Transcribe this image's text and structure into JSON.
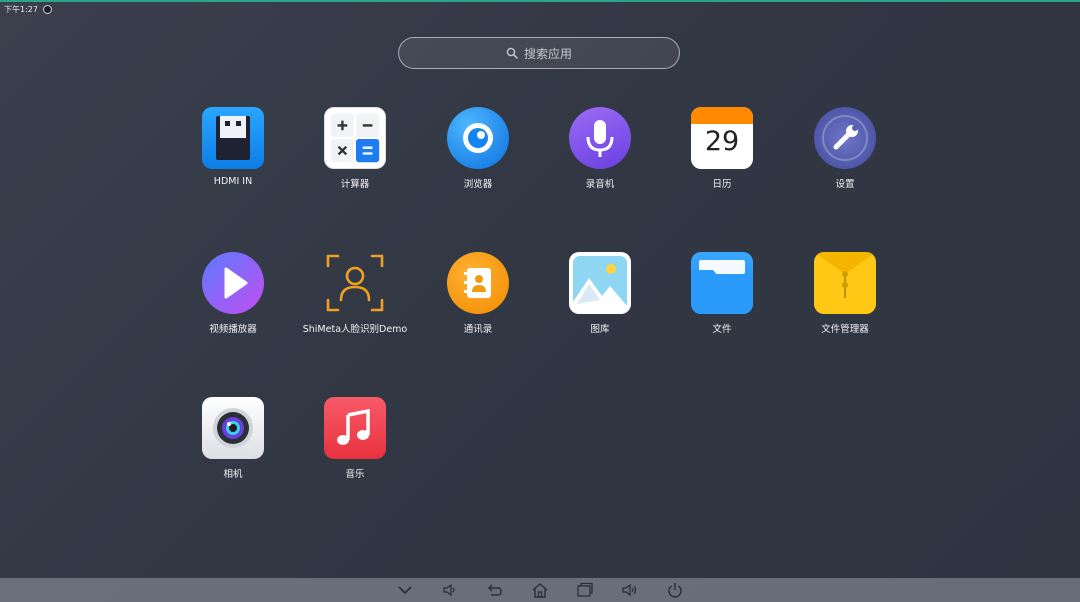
{
  "status": {
    "time": "下午1:27"
  },
  "search": {
    "placeholder": "搜索应用"
  },
  "apps": [
    {
      "id": "hdmi-in",
      "label": "HDMI IN",
      "icon": "usb-drive-icon"
    },
    {
      "id": "calculator",
      "label": "计算器",
      "icon": "calculator-icon"
    },
    {
      "id": "browser",
      "label": "浏览器",
      "icon": "browser-icon"
    },
    {
      "id": "recorder",
      "label": "录音机",
      "icon": "microphone-icon"
    },
    {
      "id": "calendar",
      "label": "日历",
      "icon": "calendar-icon",
      "day": "29"
    },
    {
      "id": "settings",
      "label": "设置",
      "icon": "wrench-icon"
    },
    {
      "id": "video-player",
      "label": "视频播放器",
      "icon": "play-icon"
    },
    {
      "id": "face-demo",
      "label": "ShiMeta人脸识别Demo",
      "icon": "face-scan-icon"
    },
    {
      "id": "contacts",
      "label": "通讯录",
      "icon": "contacts-icon"
    },
    {
      "id": "gallery",
      "label": "图库",
      "icon": "gallery-icon"
    },
    {
      "id": "files",
      "label": "文件",
      "icon": "folder-icon"
    },
    {
      "id": "file-manager",
      "label": "文件管理器",
      "icon": "file-manager-icon"
    },
    {
      "id": "camera",
      "label": "相机",
      "icon": "camera-icon"
    },
    {
      "id": "music",
      "label": "音乐",
      "icon": "music-note-icon"
    }
  ],
  "navbar": [
    {
      "id": "collapse",
      "icon": "chevron-down-icon"
    },
    {
      "id": "volume-down",
      "icon": "volume-down-icon"
    },
    {
      "id": "back",
      "icon": "back-icon"
    },
    {
      "id": "home",
      "icon": "home-icon"
    },
    {
      "id": "recents",
      "icon": "recents-icon"
    },
    {
      "id": "volume-up",
      "icon": "volume-up-icon"
    },
    {
      "id": "power",
      "icon": "power-icon"
    }
  ],
  "colors": {
    "background": "#343a46",
    "accent_line": "#2aa58a",
    "hdmi_blue": "#1a8ff5",
    "recorder_purple": "#7b5cf0",
    "calendar_orange": "#ff8a00",
    "file_yellow": "#ffc400",
    "music_red": "#f0404e"
  }
}
